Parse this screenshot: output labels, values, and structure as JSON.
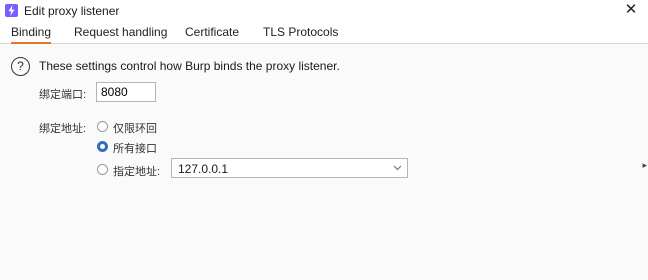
{
  "window": {
    "title": "Edit proxy listener",
    "close_label": "✕"
  },
  "tabs": [
    {
      "label": "Binding",
      "active": true
    },
    {
      "label": "Request handling",
      "active": false
    },
    {
      "label": "Certificate",
      "active": false
    },
    {
      "label": "TLS Protocols",
      "active": false
    }
  ],
  "binding": {
    "help_icon": "?",
    "help_text": "These settings control how Burp binds the proxy listener.",
    "port_label": "绑定端口:",
    "port_value": "8080",
    "address_label": "绑定地址:",
    "options": [
      {
        "label": "仅限环回",
        "selected": false
      },
      {
        "label": "所有接口",
        "selected": true
      },
      {
        "label": "指定地址:",
        "selected": false
      }
    ],
    "specific_address_value": "127.0.0.1"
  },
  "colors": {
    "accent_tab_underline": "#e8742d",
    "radio_selected": "#2f6fbd",
    "app_icon": "#7a5cff"
  },
  "icons": {
    "app": "burp-lightning-icon",
    "close": "close-icon",
    "help": "help-circle-icon",
    "dropdown": "chevron-down-icon"
  }
}
